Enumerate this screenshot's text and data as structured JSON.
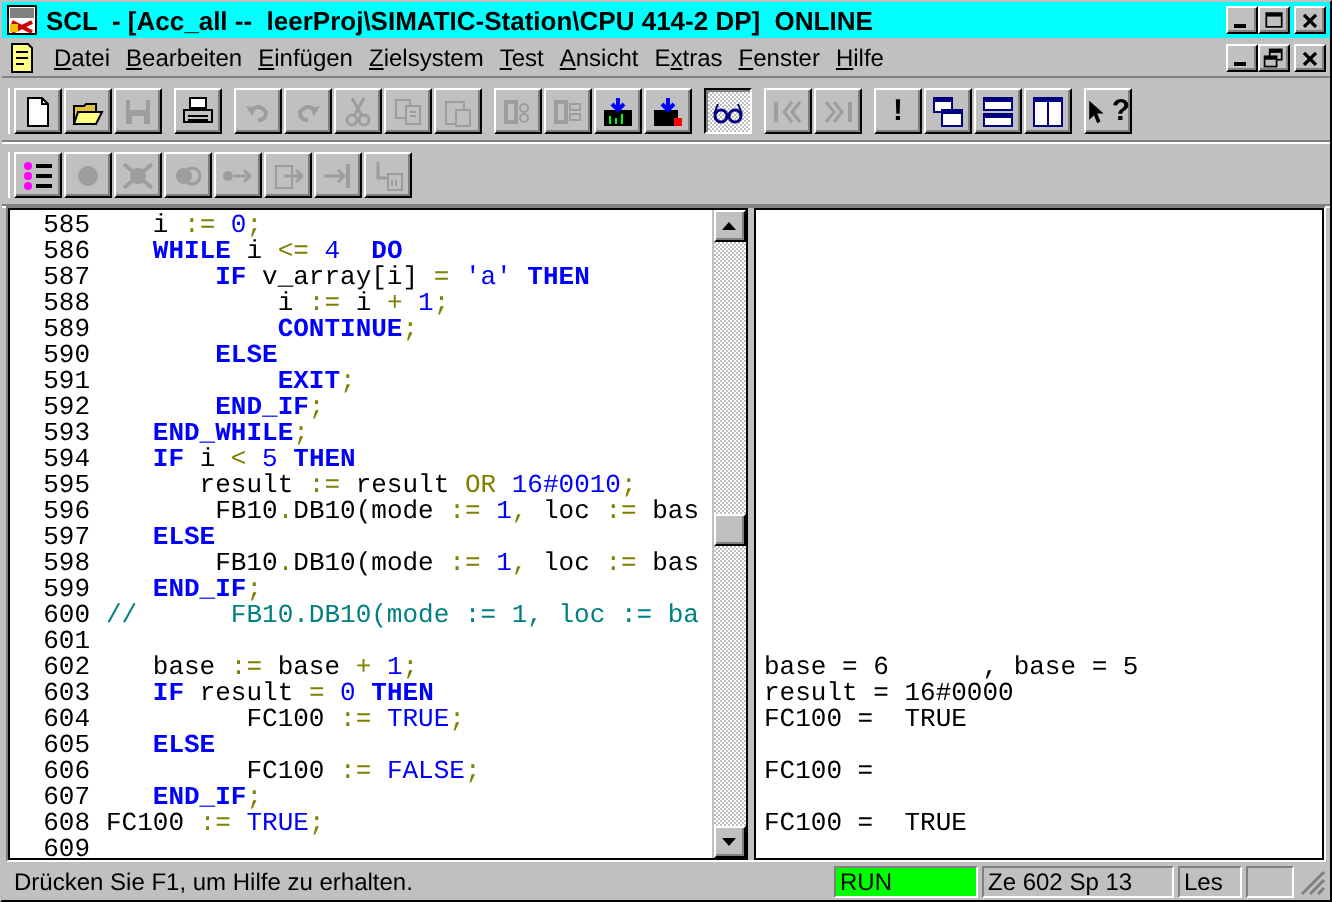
{
  "window": {
    "title": "SCL  - [Acc_all --  leerProj\\SIMATIC-Station\\CPU 414-2 DP]  ONLINE"
  },
  "menu": [
    {
      "parts": [
        {
          "text": "D",
          "underlined": true
        },
        {
          "text": "atei",
          "underlined": false
        }
      ]
    },
    {
      "parts": [
        {
          "text": "B",
          "underlined": true
        },
        {
          "text": "earbeiten",
          "underlined": false
        }
      ]
    },
    {
      "parts": [
        {
          "text": "E",
          "underlined": true
        },
        {
          "text": "infügen",
          "underlined": false
        }
      ]
    },
    {
      "parts": [
        {
          "text": "Z",
          "underlined": true
        },
        {
          "text": "ielsystem",
          "underlined": false
        }
      ]
    },
    {
      "parts": [
        {
          "text": "T",
          "underlined": true
        },
        {
          "text": "est",
          "underlined": false
        }
      ]
    },
    {
      "parts": [
        {
          "text": "A",
          "underlined": true
        },
        {
          "text": "nsicht",
          "underlined": false
        }
      ]
    },
    {
      "parts": [
        {
          "text": "E",
          "underlined": false
        },
        {
          "text": "x",
          "underlined": true
        },
        {
          "text": "tras",
          "underlined": false
        }
      ]
    },
    {
      "parts": [
        {
          "text": "F",
          "underlined": true
        },
        {
          "text": "enster",
          "underlined": false
        }
      ]
    },
    {
      "parts": [
        {
          "text": "H",
          "underlined": true
        },
        {
          "text": "ilfe",
          "underlined": false
        }
      ]
    }
  ],
  "toolbars": [
    {
      "groups": [
        {
          "buttons": [
            {
              "kind": "new",
              "disabled": false
            },
            {
              "kind": "open",
              "disabled": false
            },
            {
              "kind": "save",
              "disabled": true
            }
          ]
        },
        {
          "buttons": [
            {
              "kind": "print",
              "disabled": false
            }
          ]
        },
        {
          "buttons": [
            {
              "kind": "undo",
              "disabled": true
            },
            {
              "kind": "redo",
              "disabled": true
            },
            {
              "kind": "cut",
              "disabled": true
            },
            {
              "kind": "copy",
              "disabled": true
            },
            {
              "kind": "paste",
              "disabled": true
            }
          ]
        },
        {
          "buttons": [
            {
              "kind": "compile",
              "disabled": true
            },
            {
              "kind": "compile-all",
              "disabled": true
            },
            {
              "kind": "download",
              "disabled": false
            },
            {
              "kind": "download-all",
              "disabled": false
            }
          ]
        },
        {
          "buttons": [
            {
              "kind": "monitor",
              "disabled": false,
              "pressed": true
            }
          ]
        },
        {
          "buttons": [
            {
              "kind": "prev-mark",
              "disabled": true
            },
            {
              "kind": "next-mark",
              "disabled": true
            }
          ]
        },
        {
          "buttons": [
            {
              "kind": "run",
              "label": "!",
              "disabled": false
            },
            {
              "kind": "cascade",
              "disabled": false
            },
            {
              "kind": "tile-horizontal",
              "disabled": false
            },
            {
              "kind": "tile-vertical",
              "disabled": false
            }
          ]
        },
        {
          "buttons": [
            {
              "kind": "help",
              "label": "?",
              "disabled": false
            }
          ]
        }
      ]
    },
    {
      "groups": [
        {
          "buttons": [
            {
              "kind": "breakpoint-list",
              "disabled": false
            },
            {
              "kind": "breakpoint",
              "disabled": true
            },
            {
              "kind": "delete-breakpoints",
              "disabled": true
            },
            {
              "kind": "breakpoints-active",
              "disabled": true
            },
            {
              "kind": "next-breakpoint",
              "disabled": true
            },
            {
              "kind": "step-over",
              "disabled": true
            },
            {
              "kind": "step-into",
              "disabled": true
            },
            {
              "kind": "step-out",
              "disabled": true
            }
          ]
        }
      ]
    }
  ],
  "editor": {
    "lines": [
      {
        "number": "585",
        "tokens": [
          {
            "kind": "plain",
            "text": "   i "
          },
          {
            "kind": "op",
            "text": ":="
          },
          {
            "kind": "num",
            "text": " 0"
          },
          {
            "kind": "op",
            "text": ";"
          }
        ]
      },
      {
        "number": "586",
        "tokens": [
          {
            "kind": "kw",
            "text": "   WHILE"
          },
          {
            "kind": "plain",
            "text": " i "
          },
          {
            "kind": "op",
            "text": "<="
          },
          {
            "kind": "num",
            "text": " 4"
          },
          {
            "kind": "kw",
            "text": "  DO"
          }
        ]
      },
      {
        "number": "587",
        "tokens": [
          {
            "kind": "kw",
            "text": "       IF"
          },
          {
            "kind": "plain",
            "text": " v_array[i] "
          },
          {
            "kind": "op",
            "text": "="
          },
          {
            "kind": "num",
            "text": " 'a'"
          },
          {
            "kind": "kw",
            "text": " THEN"
          }
        ]
      },
      {
        "number": "588",
        "tokens": [
          {
            "kind": "plain",
            "text": "           i "
          },
          {
            "kind": "op",
            "text": ":="
          },
          {
            "kind": "plain",
            "text": " i "
          },
          {
            "kind": "op",
            "text": "+"
          },
          {
            "kind": "num",
            "text": " 1"
          },
          {
            "kind": "op",
            "text": ";"
          }
        ]
      },
      {
        "number": "589",
        "tokens": [
          {
            "kind": "kw",
            "text": "           CONTINUE"
          },
          {
            "kind": "op",
            "text": ";"
          }
        ]
      },
      {
        "number": "590",
        "tokens": [
          {
            "kind": "kw",
            "text": "       ELSE"
          }
        ]
      },
      {
        "number": "591",
        "tokens": [
          {
            "kind": "kw",
            "text": "           EXIT"
          },
          {
            "kind": "op",
            "text": ";"
          }
        ]
      },
      {
        "number": "592",
        "tokens": [
          {
            "kind": "kw",
            "text": "       END_IF"
          },
          {
            "kind": "op",
            "text": ";"
          }
        ]
      },
      {
        "number": "593",
        "tokens": [
          {
            "kind": "kw",
            "text": "   END_WHILE"
          },
          {
            "kind": "op",
            "text": ";"
          }
        ]
      },
      {
        "number": "594",
        "tokens": [
          {
            "kind": "kw",
            "text": "   IF"
          },
          {
            "kind": "plain",
            "text": " i "
          },
          {
            "kind": "op",
            "text": "<"
          },
          {
            "kind": "num",
            "text": " 5"
          },
          {
            "kind": "kw",
            "text": " THEN"
          }
        ]
      },
      {
        "number": "595",
        "tokens": [
          {
            "kind": "plain",
            "text": "      result "
          },
          {
            "kind": "op",
            "text": ":="
          },
          {
            "kind": "plain",
            "text": " result "
          },
          {
            "kind": "op",
            "text": "OR"
          },
          {
            "kind": "num",
            "text": " 16#0010"
          },
          {
            "kind": "op",
            "text": ";"
          }
        ]
      },
      {
        "number": "596",
        "tokens": [
          {
            "kind": "plain",
            "text": "       FB10"
          },
          {
            "kind": "op",
            "text": "."
          },
          {
            "kind": "plain",
            "text": "DB10(mode "
          },
          {
            "kind": "op",
            "text": ":="
          },
          {
            "kind": "num",
            "text": " 1"
          },
          {
            "kind": "op",
            "text": ","
          },
          {
            "kind": "plain",
            "text": " loc "
          },
          {
            "kind": "op",
            "text": ":="
          },
          {
            "kind": "plain",
            "text": " bas"
          }
        ]
      },
      {
        "number": "597",
        "tokens": [
          {
            "kind": "kw",
            "text": "   ELSE"
          }
        ]
      },
      {
        "number": "598",
        "tokens": [
          {
            "kind": "plain",
            "text": "       FB10"
          },
          {
            "kind": "op",
            "text": "."
          },
          {
            "kind": "plain",
            "text": "DB10(mode "
          },
          {
            "kind": "op",
            "text": ":="
          },
          {
            "kind": "num",
            "text": " 1"
          },
          {
            "kind": "op",
            "text": ","
          },
          {
            "kind": "plain",
            "text": " loc "
          },
          {
            "kind": "op",
            "text": ":="
          },
          {
            "kind": "plain",
            "text": " bas"
          }
        ]
      },
      {
        "number": "599",
        "tokens": [
          {
            "kind": "kw",
            "text": "   END_IF"
          },
          {
            "kind": "op",
            "text": ";"
          }
        ]
      },
      {
        "number": "600",
        "tokens": [
          {
            "kind": "comment",
            "text": "//      FB10.DB10(mode := 1, loc := ba"
          }
        ]
      },
      {
        "number": "601"
      },
      {
        "number": "602",
        "tokens": [
          {
            "kind": "plain",
            "text": "   base "
          },
          {
            "kind": "op",
            "text": ":="
          },
          {
            "kind": "plain",
            "text": " base "
          },
          {
            "kind": "op",
            "text": "+"
          },
          {
            "kind": "num",
            "text": " 1"
          },
          {
            "kind": "op",
            "text": ";"
          }
        ],
        "monitor": "base = 6      , base = 5"
      },
      {
        "number": "603",
        "tokens": [
          {
            "kind": "kw",
            "text": "   IF"
          },
          {
            "kind": "plain",
            "text": " result "
          },
          {
            "kind": "op",
            "text": "="
          },
          {
            "kind": "num",
            "text": " 0"
          },
          {
            "kind": "kw",
            "text": " THEN"
          }
        ],
        "monitor": "result = 16#0000"
      },
      {
        "number": "604",
        "tokens": [
          {
            "kind": "plain",
            "text": "         FC100 "
          },
          {
            "kind": "op",
            "text": ":="
          },
          {
            "kind": "num",
            "text": " TRUE"
          },
          {
            "kind": "op",
            "text": ";"
          }
        ],
        "monitor": "FC100 =  TRUE"
      },
      {
        "number": "605",
        "tokens": [
          {
            "kind": "kw",
            "text": "   ELSE"
          }
        ]
      },
      {
        "number": "606",
        "tokens": [
          {
            "kind": "plain",
            "text": "         FC100 "
          },
          {
            "kind": "op",
            "text": ":="
          },
          {
            "kind": "num",
            "text": " FALSE"
          },
          {
            "kind": "op",
            "text": ";"
          }
        ],
        "monitor": "FC100 ="
      },
      {
        "number": "607",
        "tokens": [
          {
            "kind": "kw",
            "text": "   END_IF"
          },
          {
            "kind": "op",
            "text": ";"
          }
        ]
      },
      {
        "number": "608",
        "tokens": [
          {
            "kind": "plain",
            "text": "FC100 "
          },
          {
            "kind": "op",
            "text": ":="
          },
          {
            "kind": "num",
            "text": " TRUE"
          },
          {
            "kind": "op",
            "text": ";"
          }
        ],
        "monitor": "FC100 =  TRUE"
      },
      {
        "number": "609"
      }
    ]
  },
  "status_bar": {
    "message": "Drücken Sie F1, um Hilfe zu erhalten.",
    "panels": [
      {
        "text": "RUN",
        "color": "#00ff00"
      },
      {
        "text": "Ze 602 Sp 13"
      },
      {
        "text": "Les"
      }
    ]
  }
}
